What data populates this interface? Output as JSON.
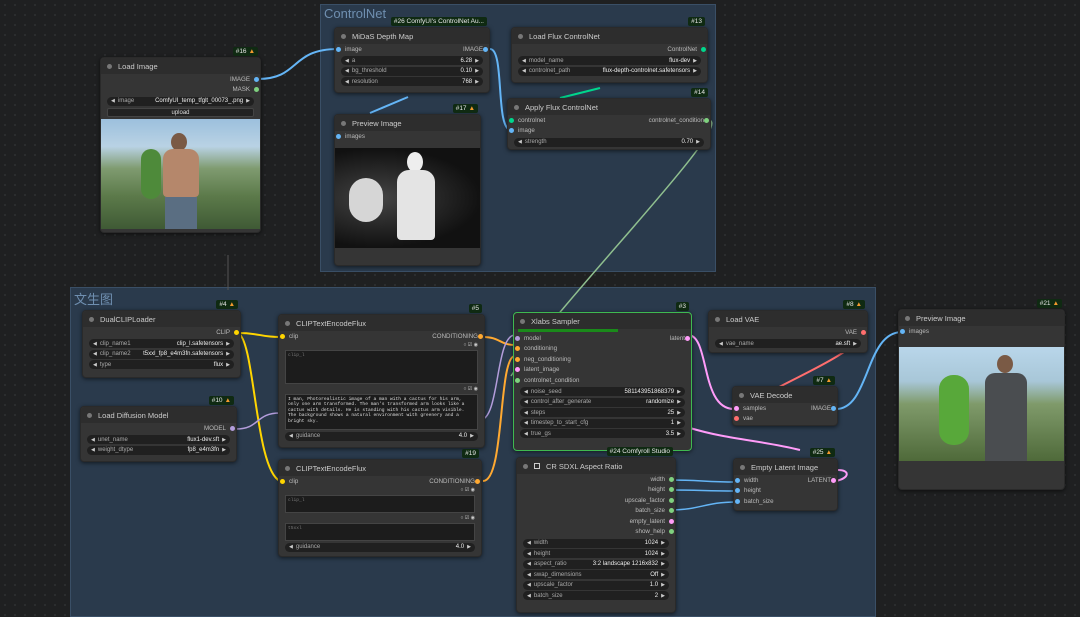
{
  "groups": {
    "controlnet": "ControlNet",
    "t2i": "文生图"
  },
  "nodes": {
    "load_image": {
      "id": "#16",
      "title": "Load Image",
      "out1": "IMAGE",
      "out2": "MASK",
      "w_image_label": "image",
      "w_image_value": "ComfyUI_temp_tfglt_00073_.png",
      "upload": "upload"
    },
    "midas": {
      "id": "#26 ComfyUI's ControlNet Au...",
      "title": "MiDaS Depth Map",
      "in1": "image",
      "out1": "IMAGE",
      "a_label": "a",
      "a_value": "6.28",
      "bg_label": "bg_threshold",
      "bg_value": "0.10",
      "res_label": "resolution",
      "res_value": "768"
    },
    "load_flux_cn": {
      "id": "#13",
      "title": "Load Flux ControlNet",
      "out1": "ControlNet",
      "model_label": "model_name",
      "model_value": "flux-dev",
      "path_label": "controlnet_path",
      "path_value": "flux-depth-controlnet.safetensors"
    },
    "apply_flux_cn": {
      "id": "#14",
      "title": "Apply Flux ControlNet",
      "in1": "controlnet",
      "in2": "image",
      "out1": "controlnet_condition",
      "strength_label": "strength",
      "strength_value": "0.70"
    },
    "preview1": {
      "id": "#17",
      "title": "Preview Image",
      "in1": "images"
    },
    "dualclip": {
      "id": "#4",
      "title": "DualCLIPLoader",
      "out1": "CLIP",
      "c1_label": "clip_name1",
      "c1_value": "clip_l.safetensors",
      "c2_label": "clip_name2",
      "c2_value": "t5xxl_fp8_e4m3fn.safetensors",
      "type_label": "type",
      "type_value": "flux"
    },
    "load_diffusion": {
      "id": "#10",
      "title": "Load Diffusion Model",
      "out1": "MODEL",
      "unet_label": "unet_name",
      "unet_value": "flux1-dev.sft",
      "wd_label": "weight_dtype",
      "wd_value": "fp8_e4m3fn"
    },
    "clipenc1": {
      "id": "#5",
      "title": "CLIPTextEncodeFlux",
      "in1": "clip",
      "out1": "CONDITIONING",
      "clip_l": "clip_l",
      "t5xxl": "I man, Photorealistic image of a man with a cactus for his arm, only one arm transformed. The man's transformed arm looks like a cactus with details. He is standing with his cactus arm visible. The background shows a natural environment with greenery and a bright sky.",
      "guidance_label": "guidance",
      "guidance_value": "4.0"
    },
    "clipenc2": {
      "id": "#19",
      "title": "CLIPTextEncodeFlux",
      "in1": "clip",
      "out1": "CONDITIONING",
      "clip_l": "clip_l",
      "t5xxl": "t5xxl",
      "guidance_label": "guidance",
      "guidance_value": "4.0"
    },
    "xlabs": {
      "id": "#3",
      "title": "Xlabs Sampler",
      "in": [
        "model",
        "conditioning",
        "neg_conditioning",
        "latent_image",
        "controlnet_condition"
      ],
      "out1": "latent",
      "w": [
        [
          "noise_seed",
          "581143951868379"
        ],
        [
          "control_after_generate",
          "randomize"
        ],
        [
          "steps",
          "25"
        ],
        [
          "timestep_to_start_cfg",
          "1"
        ],
        [
          "true_gs",
          "3.5"
        ]
      ]
    },
    "load_vae": {
      "id": "#8",
      "title": "Load VAE",
      "out1": "VAE",
      "vae_label": "vae_name",
      "vae_value": "ae.sft"
    },
    "vae_decode": {
      "id": "#7",
      "title": "VAE Decode",
      "in1": "samples",
      "in2": "vae",
      "out1": "IMAGE"
    },
    "preview2": {
      "id": "#21",
      "title": "Preview Image",
      "in1": "images"
    },
    "aspect": {
      "id": "#24 Comfyroll Studio",
      "title": "CR SDXL Aspect Ratio",
      "outs": [
        "width",
        "height",
        "upscale_factor",
        "batch_size",
        "empty_latent",
        "show_help"
      ],
      "w": [
        [
          "width",
          "1024"
        ],
        [
          "height",
          "1024"
        ],
        [
          "aspect_ratio",
          "3:2 landscape 1216x832"
        ],
        [
          "swap_dimensions",
          "Off"
        ],
        [
          "upscale_factor",
          "1.0"
        ],
        [
          "batch_size",
          "2"
        ]
      ]
    },
    "empty_latent": {
      "id": "#25",
      "title": "Empty Latent Image",
      "in": [
        "width",
        "height",
        "batch_size"
      ],
      "out1": "LATENT"
    }
  },
  "colors": {
    "clip": "#ffd500",
    "conditioning": "#ffa931",
    "image": "#64b5f6",
    "model": "#b39ddb",
    "vae": "#ff6e6e",
    "latent": "#ff9cf9",
    "controlnet": "#00d78d",
    "int": "#7fd17f"
  }
}
